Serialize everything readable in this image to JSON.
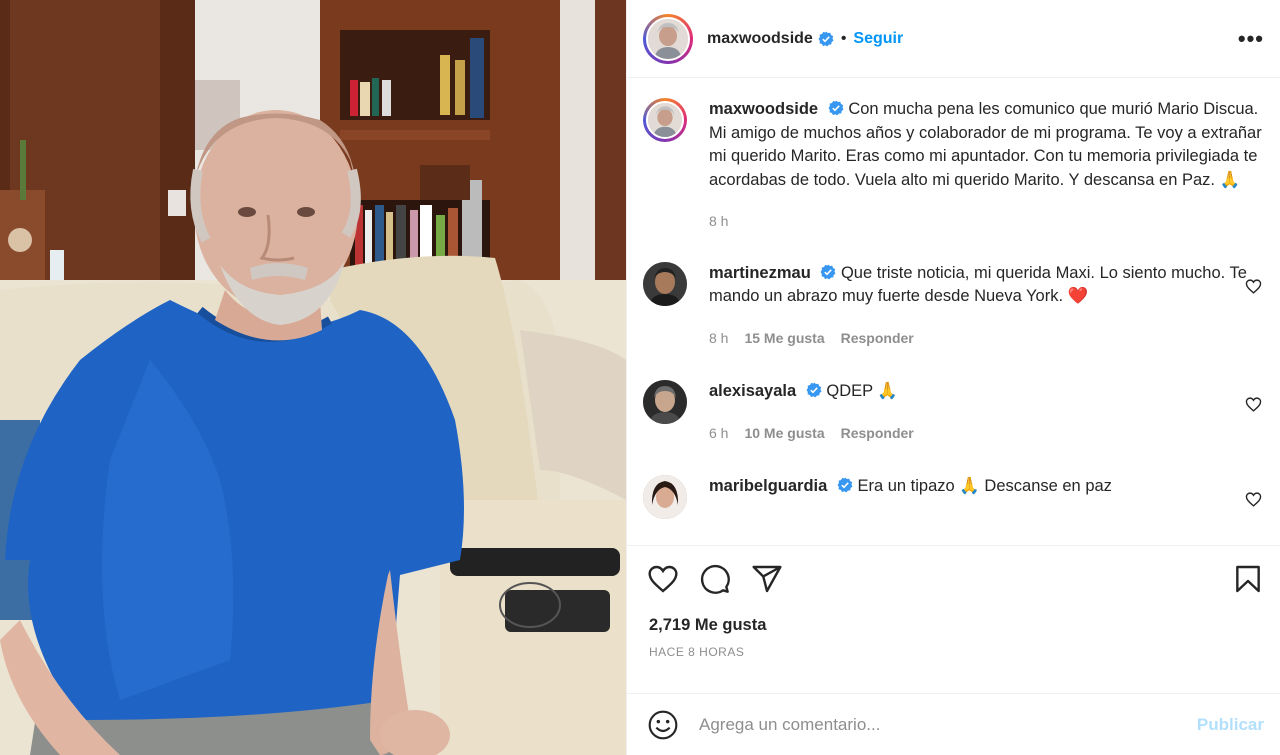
{
  "header": {
    "username": "maxwoodside",
    "follow_label": "Seguir",
    "separator": "•",
    "more_label": "•••"
  },
  "caption": {
    "username": "maxwoodside",
    "text": "Con mucha pena les comunico que murió Mario Discua. Mi amigo de muchos años y colaborador de mi programa. Te voy a extrañar mi querido Marito. Eras como mi apuntador. Con tu memoria privilegiada te acordabas de todo. Vuela alto mi querido Marito. Y descansa en Paz. 🙏",
    "time": "8 h"
  },
  "comments": [
    {
      "username": "martinezmau",
      "text": "Que triste noticia, mi querida Maxi. Lo siento mucho. Te mando un abrazo muy fuerte desde Nueva York. ❤️",
      "time": "8 h",
      "likes": "15 Me gusta",
      "reply": "Responder"
    },
    {
      "username": "alexisayala",
      "text": "QDEP 🙏",
      "time": "6 h",
      "likes": "10 Me gusta",
      "reply": "Responder"
    },
    {
      "username": "maribelguardia",
      "text": "Era un tipazo 🙏 Descanse en paz",
      "time": "",
      "likes": "",
      "reply": ""
    }
  ],
  "stats": {
    "likes": "2,719 Me gusta",
    "posted": "HACE 8 HORAS"
  },
  "add_comment": {
    "placeholder": "Agrega un comentario...",
    "publish_label": "Publicar"
  },
  "colors": {
    "accent": "#0095f6",
    "verified": "#3897f0",
    "muted": "#8e8e8e",
    "publish_disabled": "#b2dffc"
  }
}
